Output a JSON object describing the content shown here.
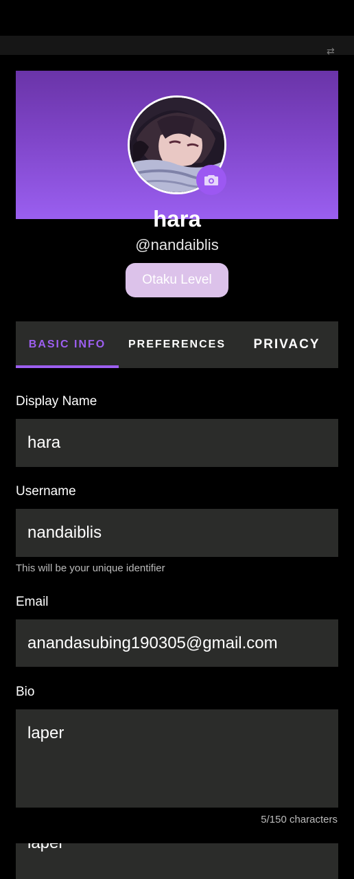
{
  "profile": {
    "name": "hara",
    "handle": "@nandaiblis",
    "level_button": "Otaku Level"
  },
  "tabs": [
    {
      "label": "BASIC INFO",
      "active": true
    },
    {
      "label": "PREFERENCES",
      "active": false
    },
    {
      "label": "PRIVACY",
      "active": false
    }
  ],
  "form": {
    "display_name": {
      "label": "Display Name",
      "value": "hara"
    },
    "username": {
      "label": "Username",
      "value": "nandaiblis",
      "helper": "This will be your unique identifier"
    },
    "email": {
      "label": "Email",
      "value": "anandasubing190305@gmail.com"
    },
    "bio": {
      "label": "Bio",
      "value": "laper",
      "counter": "5/150 characters"
    },
    "overflow_preview": "laper"
  },
  "colors": {
    "accent": "#9d5ff0",
    "field_bg": "#2b2c2a",
    "level_btn_bg": "#dcc2ea"
  },
  "icons": {
    "camera": "camera-icon",
    "avatar": "anime-avatar"
  }
}
